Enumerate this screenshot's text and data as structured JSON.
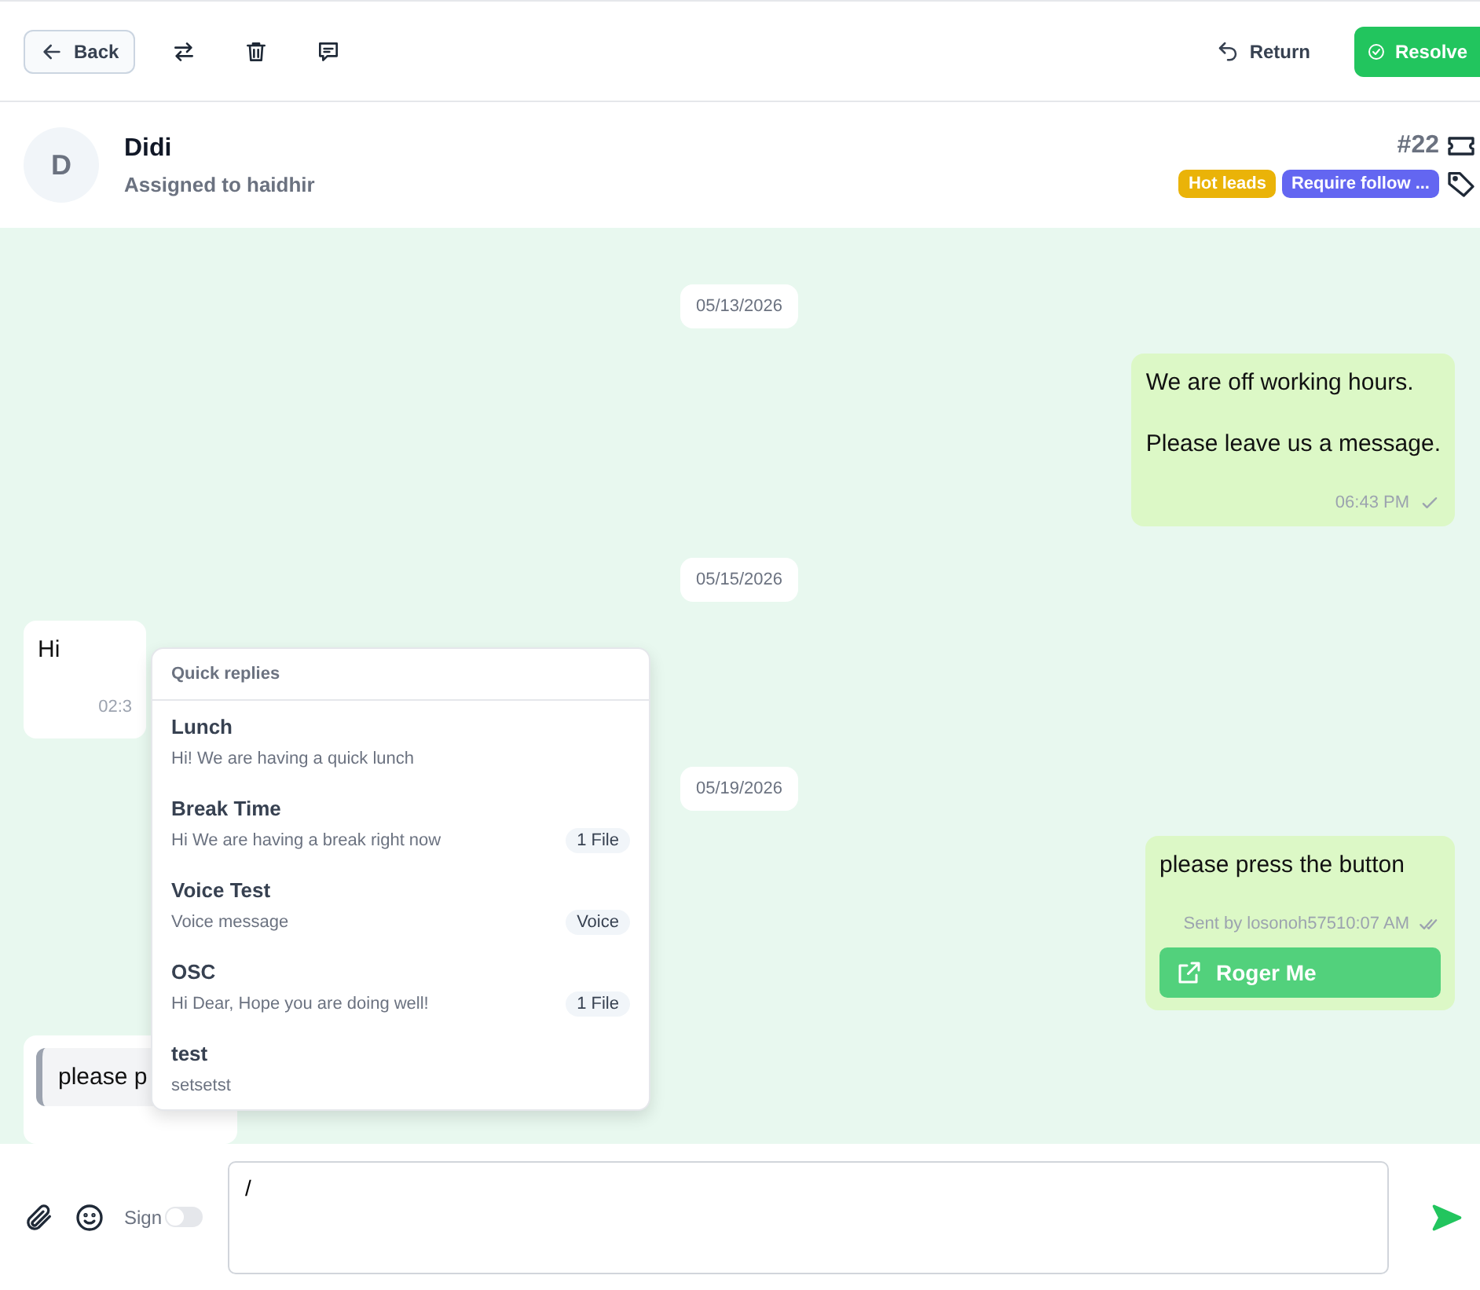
{
  "toolbar": {
    "back": "Back",
    "return": "Return",
    "resolve": "Resolve"
  },
  "contact": {
    "initial": "D",
    "name": "Didi",
    "assigned": "Assigned to haidhir",
    "ticket": "#22",
    "tags": [
      {
        "label": "Hot leads",
        "color": "#eab308"
      },
      {
        "label": "Require follow ...",
        "color": "#6366f1"
      }
    ]
  },
  "messages": [
    {
      "kind": "date",
      "text": "05/13/2026"
    },
    {
      "kind": "outgoing",
      "lines": [
        "We are off working hours.",
        "Please leave us a message."
      ],
      "time": "06:43 PM",
      "read": false
    },
    {
      "kind": "date",
      "text": "05/15/2026"
    },
    {
      "kind": "incoming",
      "lines": [
        "Hi"
      ],
      "time": "02:3"
    },
    {
      "kind": "date",
      "text": "05/19/2026"
    },
    {
      "kind": "outgoing",
      "lines": [
        "please press the button"
      ],
      "sender": "Sent by losonoh575",
      "time": "10:07 AM",
      "read": true,
      "button": "Roger Me"
    },
    {
      "kind": "quoted",
      "quote": "please p"
    }
  ],
  "quick_replies": {
    "title": "Quick replies",
    "items": [
      {
        "name": "Lunch",
        "text": "Hi! We are having a quick lunch"
      },
      {
        "name": "Break Time",
        "text": "Hi We are having a break right now",
        "badge": "1 File"
      },
      {
        "name": "Voice Test",
        "text": "Voice message",
        "badge": "Voice"
      },
      {
        "name": "OSC",
        "text": "Hi Dear, Hope you are doing well!",
        "badge": "1 File"
      },
      {
        "name": "test",
        "text": "setsetst"
      }
    ]
  },
  "composer": {
    "sign_label": "Sign",
    "sign_on": false,
    "value": "/"
  }
}
